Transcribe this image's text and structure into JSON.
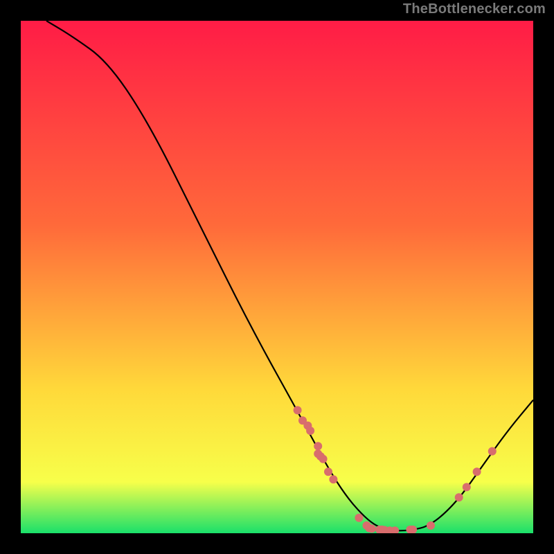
{
  "attribution": "TheBottlenecker.com",
  "colors": {
    "top": "#ff1c46",
    "mid1": "#ff6a3a",
    "mid2": "#ffd93a",
    "mid3": "#f7ff4a",
    "bottom": "#19e06a",
    "curve": "#000000",
    "marker": "#d86d6d",
    "marker_stroke": "#b04848",
    "frame": "#000000"
  },
  "chart_data": {
    "type": "line",
    "title": "",
    "xlabel": "",
    "ylabel": "",
    "xlim": [
      0,
      100
    ],
    "ylim": [
      0,
      100
    ],
    "curve": [
      {
        "x": 5,
        "y": 100
      },
      {
        "x": 10,
        "y": 97
      },
      {
        "x": 17,
        "y": 92
      },
      {
        "x": 25,
        "y": 80
      },
      {
        "x": 35,
        "y": 60
      },
      {
        "x": 45,
        "y": 40
      },
      {
        "x": 55,
        "y": 22
      },
      {
        "x": 62,
        "y": 9
      },
      {
        "x": 68,
        "y": 2
      },
      {
        "x": 72,
        "y": 0.5
      },
      {
        "x": 76,
        "y": 0.5
      },
      {
        "x": 80,
        "y": 1.5
      },
      {
        "x": 85,
        "y": 6
      },
      {
        "x": 90,
        "y": 13
      },
      {
        "x": 95,
        "y": 20
      },
      {
        "x": 100,
        "y": 26
      }
    ],
    "markers": [
      {
        "x": 54,
        "y": 24
      },
      {
        "x": 55,
        "y": 22
      },
      {
        "x": 56,
        "y": 21
      },
      {
        "x": 56.5,
        "y": 20
      },
      {
        "x": 58,
        "y": 17
      },
      {
        "x": 58,
        "y": 15.5
      },
      {
        "x": 58.5,
        "y": 15
      },
      {
        "x": 59,
        "y": 14.5
      },
      {
        "x": 60,
        "y": 12
      },
      {
        "x": 61,
        "y": 10.5
      },
      {
        "x": 66,
        "y": 3
      },
      {
        "x": 67.5,
        "y": 1.5
      },
      {
        "x": 68,
        "y": 1.0
      },
      {
        "x": 68.5,
        "y": 0.9
      },
      {
        "x": 70,
        "y": 0.7
      },
      {
        "x": 70.5,
        "y": 0.7
      },
      {
        "x": 71,
        "y": 0.6
      },
      {
        "x": 72,
        "y": 0.5
      },
      {
        "x": 73,
        "y": 0.5
      },
      {
        "x": 76,
        "y": 0.7
      },
      {
        "x": 76.5,
        "y": 0.7
      },
      {
        "x": 80,
        "y": 1.5
      },
      {
        "x": 85.5,
        "y": 7
      },
      {
        "x": 87,
        "y": 9
      },
      {
        "x": 89,
        "y": 12
      },
      {
        "x": 92,
        "y": 16
      }
    ],
    "gradient_stops": [
      {
        "offset": 0.0,
        "key": "top"
      },
      {
        "offset": 0.4,
        "key": "mid1"
      },
      {
        "offset": 0.72,
        "key": "mid2"
      },
      {
        "offset": 0.9,
        "key": "mid3"
      },
      {
        "offset": 1.0,
        "key": "bottom"
      }
    ]
  }
}
